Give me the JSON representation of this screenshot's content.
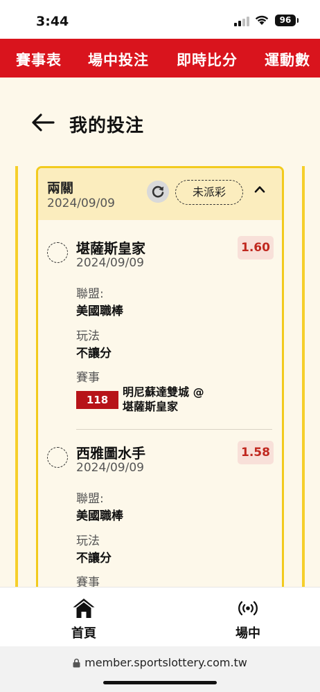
{
  "status_bar": {
    "time": "3:44",
    "battery": "96"
  },
  "top_nav": {
    "items": [
      {
        "label": "賽事表"
      },
      {
        "label": "場中投注"
      },
      {
        "label": "即時比分"
      },
      {
        "label": "運動數"
      }
    ],
    "accent": "#d9141d"
  },
  "header": {
    "title": "我的投注"
  },
  "bet_card": {
    "type": "兩關",
    "date": "2024/09/09",
    "status": "未派彩",
    "legs": [
      {
        "team": "堪薩斯皇家",
        "date": "2024/09/09",
        "odds": "1.60",
        "league_label": "聯盟:",
        "league": "美國職棒",
        "market_label": "玩法",
        "market": "不讓分",
        "match_label": "賽事",
        "match_no": "118",
        "match_line1": "明尼蘇達雙城 @",
        "match_line2": "堪薩斯皇家"
      },
      {
        "team": "西雅圖水手",
        "date": "2024/09/09",
        "odds": "1.58",
        "league_label": "聯盟:",
        "league": "美國職棒",
        "market_label": "玩法",
        "market": "不讓分",
        "match_label": "賽事"
      }
    ]
  },
  "tab_bar": {
    "items": [
      {
        "label": "首頁",
        "icon": "home-icon"
      },
      {
        "label": "場中",
        "icon": "live-icon"
      }
    ]
  },
  "browser": {
    "url": "member.sportslottery.com.tw"
  }
}
